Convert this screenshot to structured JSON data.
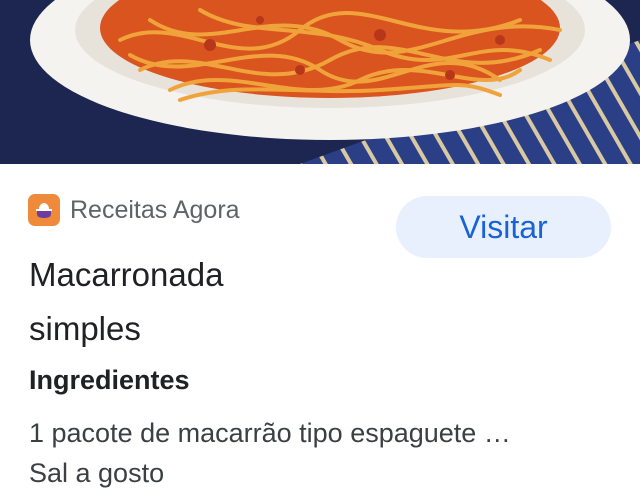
{
  "source": {
    "name": "Receitas Agora",
    "icon": "recipe-pot-icon",
    "icon_color": "#f08a3b"
  },
  "visit_button": {
    "label": "Visitar",
    "color": "#1a63d6",
    "background": "#e8f0fe"
  },
  "recipe": {
    "title_line1": "Macarronada",
    "title_line2": "simples"
  },
  "ingredients": {
    "heading": "Ingredientes",
    "items": [
      "1 pacote de macarrão tipo espaguete …",
      "Sal a gosto"
    ]
  },
  "hero_image": {
    "subject": "spaghetti-dish-photo"
  }
}
